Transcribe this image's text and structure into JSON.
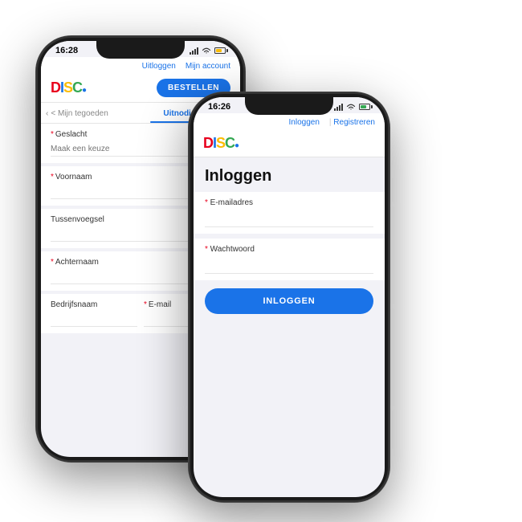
{
  "phone1": {
    "statusBar": {
      "time": "16:28",
      "signal": "signal",
      "wifi": "wifi",
      "battery": "battery"
    },
    "nav": {
      "link1": "Uitloggen",
      "link2": "Mijn account"
    },
    "logo": "DISC",
    "btnBestellen": "BESTELLEN",
    "tabs": {
      "tab1": "< Mijn tegoeden",
      "tab2": "Uitnodigingen"
    },
    "fields": [
      {
        "label": "Geslacht",
        "required": true,
        "placeholder": "Maak een keuze"
      },
      {
        "label": "Voornaam",
        "required": true,
        "placeholder": ""
      },
      {
        "label": "Tussenvoegsel",
        "required": false,
        "placeholder": ""
      },
      {
        "label": "Achternaam",
        "required": true,
        "placeholder": ""
      }
    ],
    "fieldsRow": {
      "field1": "Bedrijfsnaam",
      "field2": "E-mail",
      "required": true
    }
  },
  "phone2": {
    "statusBar": {
      "time": "16:26",
      "signal": "signal",
      "wifi": "wifi",
      "battery": "battery"
    },
    "nav": {
      "link1": "Inloggen",
      "link2": "Registreren"
    },
    "logo": "DISC",
    "loginTitle": "Inloggen",
    "fields": [
      {
        "label": "E-mailadres",
        "required": true,
        "value": ""
      },
      {
        "label": "Wachtwoord",
        "required": true,
        "value": ""
      }
    ],
    "btnInloggen": "INLOGGEN"
  }
}
